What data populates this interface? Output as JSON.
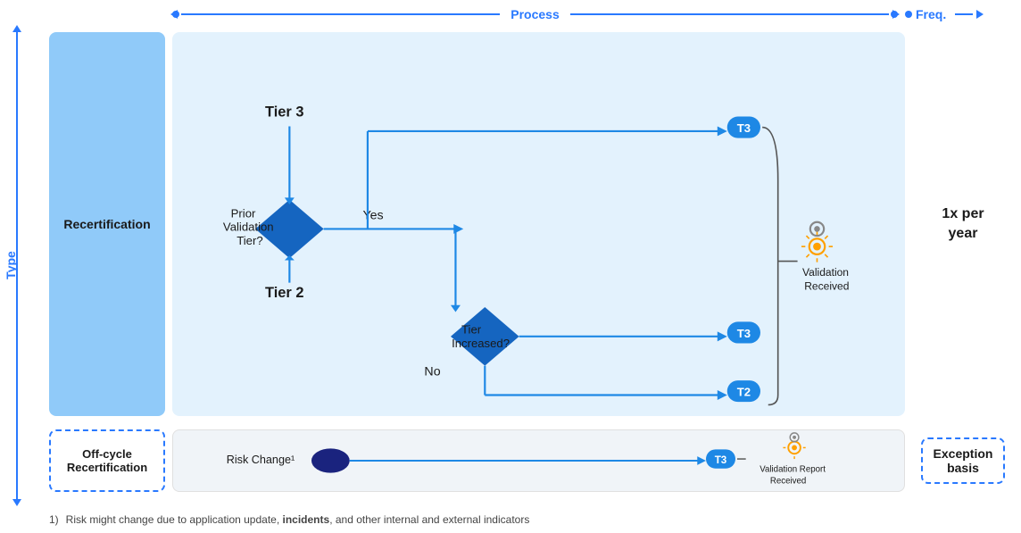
{
  "header": {
    "process_label": "Process",
    "freq_label": "Freq.",
    "type_label": "Type"
  },
  "recertification": {
    "label": "Recertification",
    "offcycle_label": "Off-cycle\nRecertification"
  },
  "flow": {
    "tier3_label": "Tier 3",
    "tier2_label": "Tier 2",
    "prior_validation": "Prior\nValidation\nTier?",
    "tier_increased": "Tier\nIncreased?",
    "yes_label": "Yes",
    "no_label": "No",
    "t3_badge": "T3",
    "t2_badge": "T2",
    "validation_received": "Validation\nReceived",
    "risk_change": "Risk Change¹",
    "validation_report": "Validation Report\nReceived"
  },
  "frequency": {
    "upper": "1x per\nyear",
    "lower_label": "Exception\nbasis"
  },
  "footer": {
    "note_num": "1)",
    "note_text": "Risk might change due to application update, ",
    "note_bold": "incidents",
    "note_rest": ", and other internal and external indicators"
  },
  "colors": {
    "blue_primary": "#2979FF",
    "blue_light": "#90CAF9",
    "blue_bg": "#E3F2FD",
    "diamond_fill": "#1565C0",
    "badge_blue": "#1E88E5",
    "oval_dark": "#1A237E"
  }
}
